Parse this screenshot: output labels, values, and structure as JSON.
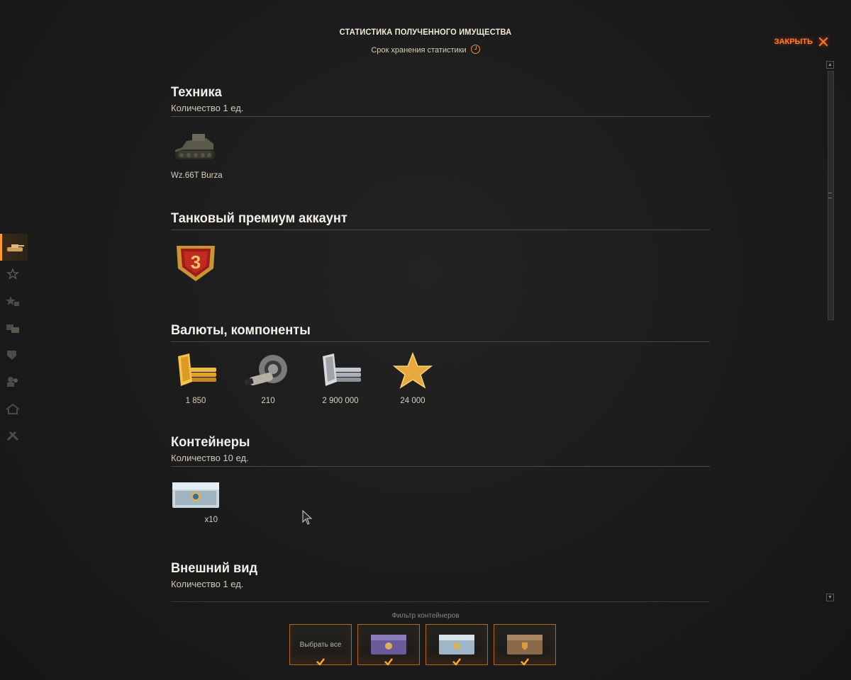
{
  "header": {
    "title": "СТАТИСТИКА ПОЛУЧЕННОГО ИМУЩЕСТВА",
    "subtitle": "Срок хранения статистики",
    "close_label": "ЗАКРЫТЬ"
  },
  "sections": {
    "vehicles": {
      "title": "Техника",
      "subtitle": "Количество 1 ед.",
      "items": [
        {
          "name": "Wz.66T Burza",
          "icon": "tank-icon"
        }
      ]
    },
    "premium": {
      "title": "Танковый премиум аккаунт",
      "items": [
        {
          "name": "3",
          "icon": "premium-3-days-badge-icon"
        }
      ]
    },
    "currencies": {
      "title": "Валюты, компоненты",
      "items": [
        {
          "value": "1 850",
          "icon": "gold-icon"
        },
        {
          "value": "210",
          "icon": "equipment-parts-icon"
        },
        {
          "value": "2 900 000",
          "icon": "credits-icon"
        },
        {
          "value": "24 000",
          "icon": "free-xp-star-icon"
        }
      ]
    },
    "containers": {
      "title": "Контейнеры",
      "subtitle": "Количество 10 ед.",
      "items": [
        {
          "value": "x10",
          "icon": "container-silver-icon"
        }
      ]
    },
    "appearance": {
      "title": "Внешний вид",
      "subtitle": "Количество 1 ед."
    }
  },
  "filter": {
    "label": "Фильтр контейнеров",
    "select_all": "Выбрать все",
    "options": [
      {
        "icon": "container-purple-icon",
        "color": "#6a5a9a"
      },
      {
        "icon": "container-silver-icon",
        "color": "#9fb6c8"
      },
      {
        "icon": "container-bronze-icon",
        "color": "#8a6a4a"
      }
    ]
  },
  "colors": {
    "accent": "#ff7a2a",
    "background": "#1c1c1d"
  }
}
